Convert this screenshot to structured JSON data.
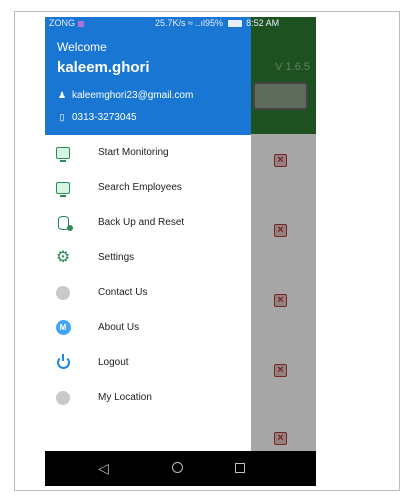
{
  "status_bar": {
    "carrier": "ZONG",
    "right_text": "25.7K/s",
    "signal_text": "..ıl95%",
    "time": "8:52 AM"
  },
  "background_app": {
    "version": "V 1.6.5"
  },
  "drawer": {
    "welcome": "Welcome",
    "username": "kaleem.ghori",
    "email": "kaleemghori23@gmail.com",
    "phone": "0313-3273045",
    "items": [
      {
        "label": "Start Monitoring",
        "icon": "monitor-icon"
      },
      {
        "label": "Search Employees",
        "icon": "monitor-search-icon"
      },
      {
        "label": "Back Up and Reset",
        "icon": "database-icon"
      },
      {
        "label": "Settings",
        "icon": "gear-icon"
      },
      {
        "label": "Contact Us",
        "icon": "contact-icon"
      },
      {
        "label": "About Us",
        "icon": "about-icon"
      },
      {
        "label": "Logout",
        "icon": "power-icon"
      },
      {
        "label": "My Location",
        "icon": "location-icon"
      }
    ]
  },
  "colors": {
    "drawer_header": "#1976d2",
    "app_header": "#2e7d32",
    "delete_icon": "#b23a3a"
  }
}
